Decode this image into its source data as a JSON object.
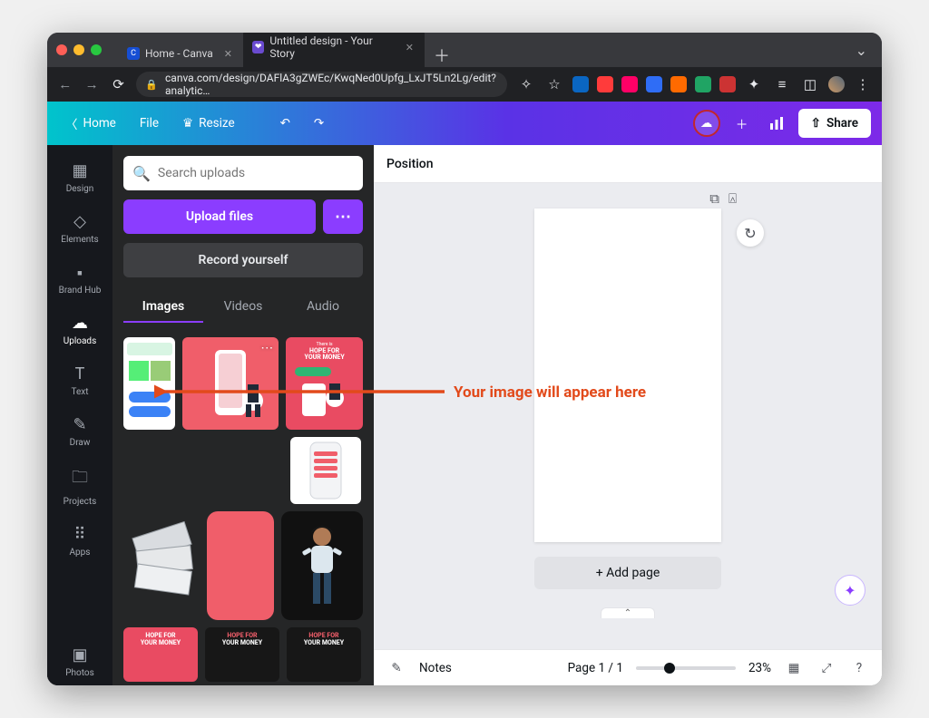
{
  "browser": {
    "tabs": [
      {
        "title": "Home - Canva",
        "favicon_bg": "#164ed4",
        "favicon_text": "C"
      },
      {
        "title": "Untitled design - Your Story",
        "favicon_bg": "#6a4bd0",
        "favicon_text": "❤"
      }
    ],
    "url_display": "canva.com/design/DAFlA3gZWEc/KwqNed0Upfg_LxJT5Ln2Lg/edit?analytic…"
  },
  "header": {
    "home": "Home",
    "file": "File",
    "resize": "Resize",
    "share": "Share"
  },
  "rail": {
    "items": [
      {
        "label": "Design",
        "icon": "⌂"
      },
      {
        "label": "Elements",
        "icon": "⬡"
      },
      {
        "label": "Brand Hub",
        "icon": "🗄"
      },
      {
        "label": "Uploads",
        "icon": "☁"
      },
      {
        "label": "Text",
        "icon": "T"
      },
      {
        "label": "Draw",
        "icon": "✎"
      },
      {
        "label": "Projects",
        "icon": "🗀"
      },
      {
        "label": "Apps",
        "icon": "⠿"
      }
    ],
    "bottom": {
      "label": "Photos",
      "icon": "▧"
    }
  },
  "panel": {
    "search_placeholder": "Search uploads",
    "upload_files": "Upload files",
    "record_yourself": "Record yourself",
    "subtabs": [
      "Images",
      "Videos",
      "Audio"
    ],
    "hope_line1": "There is",
    "hope_line2": "HOPE FOR",
    "hope_line3": "YOUR MONEY"
  },
  "canvas": {
    "toolbar_label": "Position",
    "add_page": "+ Add page"
  },
  "bottom": {
    "notes": "Notes",
    "page_label": "Page 1 / 1",
    "zoom": "23%"
  },
  "annotation": {
    "text": "Your image will appear here"
  }
}
